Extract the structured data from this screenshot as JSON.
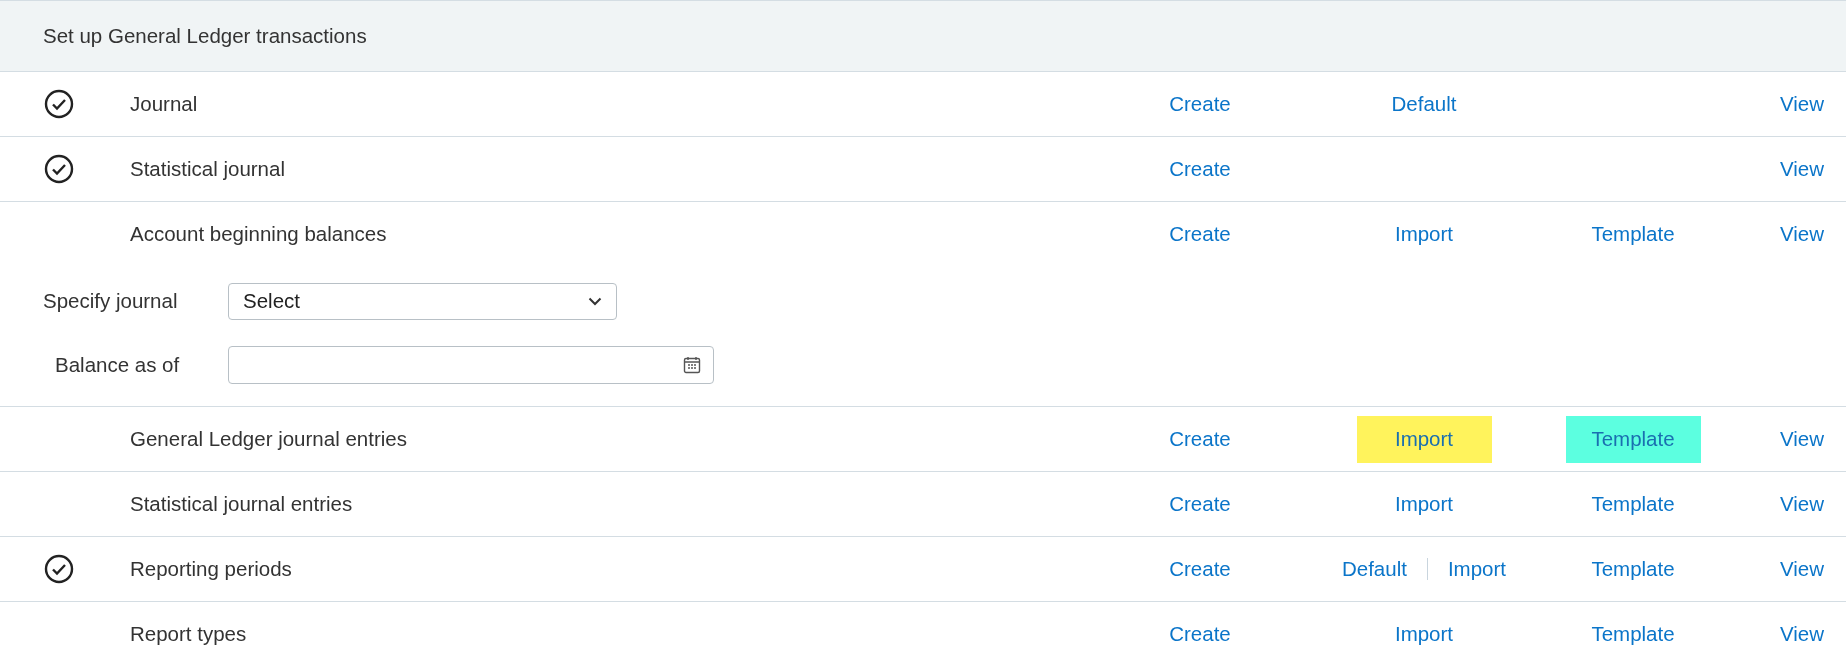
{
  "header": {
    "title": "Set up General Ledger transactions"
  },
  "rows": [
    {
      "label": "Journal",
      "complete": true,
      "links": [
        {
          "label": "Create",
          "kind": "create"
        },
        {
          "label": "Default",
          "kind": "middle"
        },
        {
          "label": "View",
          "kind": "view"
        }
      ]
    },
    {
      "label": "Statistical journal",
      "complete": true,
      "links": [
        {
          "label": "Create",
          "kind": "create"
        },
        {
          "label": "View",
          "kind": "view"
        }
      ]
    },
    {
      "label": "Account beginning balances",
      "complete": false,
      "links": [
        {
          "label": "Create",
          "kind": "create"
        },
        {
          "label": "Import",
          "kind": "middle"
        },
        {
          "label": "Template",
          "kind": "template"
        },
        {
          "label": "View",
          "kind": "view"
        }
      ],
      "form": {
        "journal": {
          "label": "Specify journal",
          "value": "Select"
        },
        "balance_date": {
          "label": "Balance as of"
        }
      }
    },
    {
      "label": "General Ledger journal entries",
      "complete": false,
      "links": [
        {
          "label": "Create",
          "kind": "create"
        },
        {
          "label": "Import",
          "kind": "middle",
          "color": "#fff35c"
        },
        {
          "label": "Template",
          "kind": "template",
          "color": "#5cffe0"
        },
        {
          "label": "View",
          "kind": "view"
        }
      ]
    },
    {
      "label": "Statistical journal entries",
      "complete": false,
      "links": [
        {
          "label": "Create",
          "kind": "create"
        },
        {
          "label": "Import",
          "kind": "middle"
        },
        {
          "label": "Template",
          "kind": "template"
        },
        {
          "label": "View",
          "kind": "view"
        }
      ]
    },
    {
      "label": "Reporting periods",
      "complete": true,
      "links": [
        {
          "label": "Create",
          "kind": "create"
        },
        {
          "label": "Default",
          "kind": "middle"
        },
        {
          "label": "Import",
          "kind": "middle"
        },
        {
          "label": "Template",
          "kind": "template"
        },
        {
          "label": "View",
          "kind": "view"
        }
      ]
    },
    {
      "label": "Report types",
      "complete": false,
      "links": [
        {
          "label": "Create",
          "kind": "create"
        },
        {
          "label": "Import",
          "kind": "middle"
        },
        {
          "label": "Template",
          "kind": "template"
        },
        {
          "label": "View",
          "kind": "view"
        }
      ]
    }
  ]
}
